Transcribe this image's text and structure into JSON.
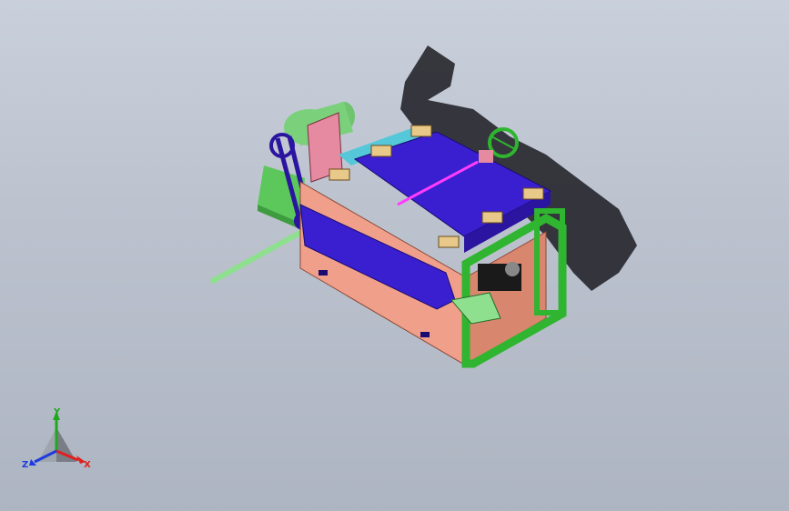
{
  "viewport": {
    "background_top": "#c9d0db",
    "background_bottom": "#aeb5c2"
  },
  "model": {
    "colors": {
      "frame_salmon": "#f0a08a",
      "frame_salmon_dark": "#d9866f",
      "top_plate": "#3a1fd0",
      "top_plate_dark": "#2a14a0",
      "pink_post": "#e58aa0",
      "green_frame": "#2fb52f",
      "green_light": "#8ee08e",
      "cyan": "#54c8d8",
      "shaft_glow": "#ff3cff",
      "wood_block": "#e8c98a",
      "shadow": "#1c1c22"
    }
  },
  "triad": {
    "x_label": "X",
    "y_label": "Y",
    "z_label": "Z",
    "x_color": "#e0201e",
    "y_color": "#1fa81f",
    "z_color": "#1e3be0"
  }
}
